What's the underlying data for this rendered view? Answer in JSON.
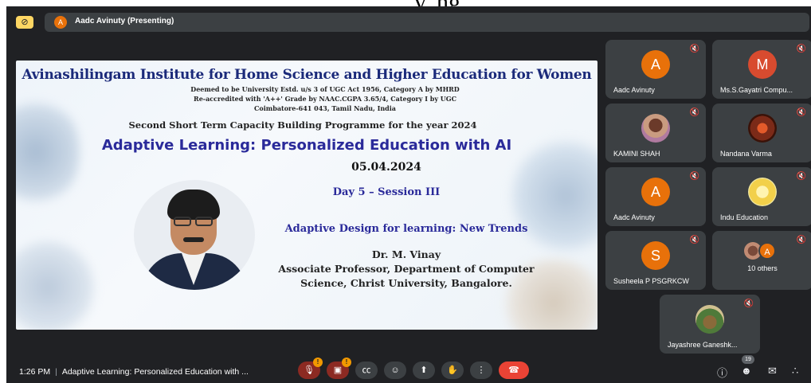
{
  "top_text": "y, ng",
  "presenting": {
    "avatar_letter": "A",
    "label": "Aadc Avinuty (Presenting)"
  },
  "slide": {
    "institute": "Avinashilingam Institute for Home Science and Higher Education for Women",
    "sub1": "Deemed to be University Estd. u/s 3 of UGC Act 1956, Category A by MHRD",
    "sub2": "Re-accredited with 'A++' Grade by NAAC.CGPA 3.65/4, Category I by UGC",
    "sub3": "Coimbatore-641 043, Tamil Nadu, India",
    "programme": "Second Short Term Capacity Building Programme for the year 2024",
    "title": "Adaptive Learning: Personalized Education with AI",
    "date": "05.04.2024",
    "day": "Day 5 – Session III",
    "topic": "Adaptive Design for learning: New Trends",
    "speaker": "Dr. M. Vinay",
    "role1": "Associate Professor, Department of Computer",
    "role2": "Science, Christ University, Bangalore."
  },
  "participants": [
    {
      "name": "Aadc Avinuty",
      "avatar": "A"
    },
    {
      "name": "Ms.S.Gayatri Compu...",
      "avatar": "M"
    },
    {
      "name": "KAMINI SHAH",
      "avatar": ""
    },
    {
      "name": "Nandana Varma",
      "avatar": ""
    },
    {
      "name": "Aadc Avinuty",
      "avatar": "A"
    },
    {
      "name": "Indu Education",
      "avatar": ""
    },
    {
      "name": "Susheela P PSGRKCW",
      "avatar": "S"
    },
    {
      "name": "10 others",
      "avatar": "A"
    },
    {
      "name": "Jayashree Ganeshk...",
      "avatar": ""
    }
  ],
  "bottom": {
    "time": "1:26 PM",
    "meeting_title": "Adaptive Learning: Personalized Education with ...",
    "participant_count": "19",
    "badge": "!"
  },
  "icons": {
    "camera_off": "camera-off-icon",
    "mic_off": "mic-off-icon",
    "captions": "captions-icon",
    "emoji": "emoji-icon",
    "present": "present-icon",
    "raise_hand": "raise-hand-icon",
    "more": "more-vert-icon",
    "hangup": "hangup-icon",
    "info": "info-icon",
    "people": "people-icon",
    "chat": "chat-icon",
    "activities": "activities-icon"
  },
  "colors": {
    "background": "#202124",
    "tile": "#3c4043",
    "hangup": "#ea4335",
    "accent_orange": "#e8710a"
  }
}
